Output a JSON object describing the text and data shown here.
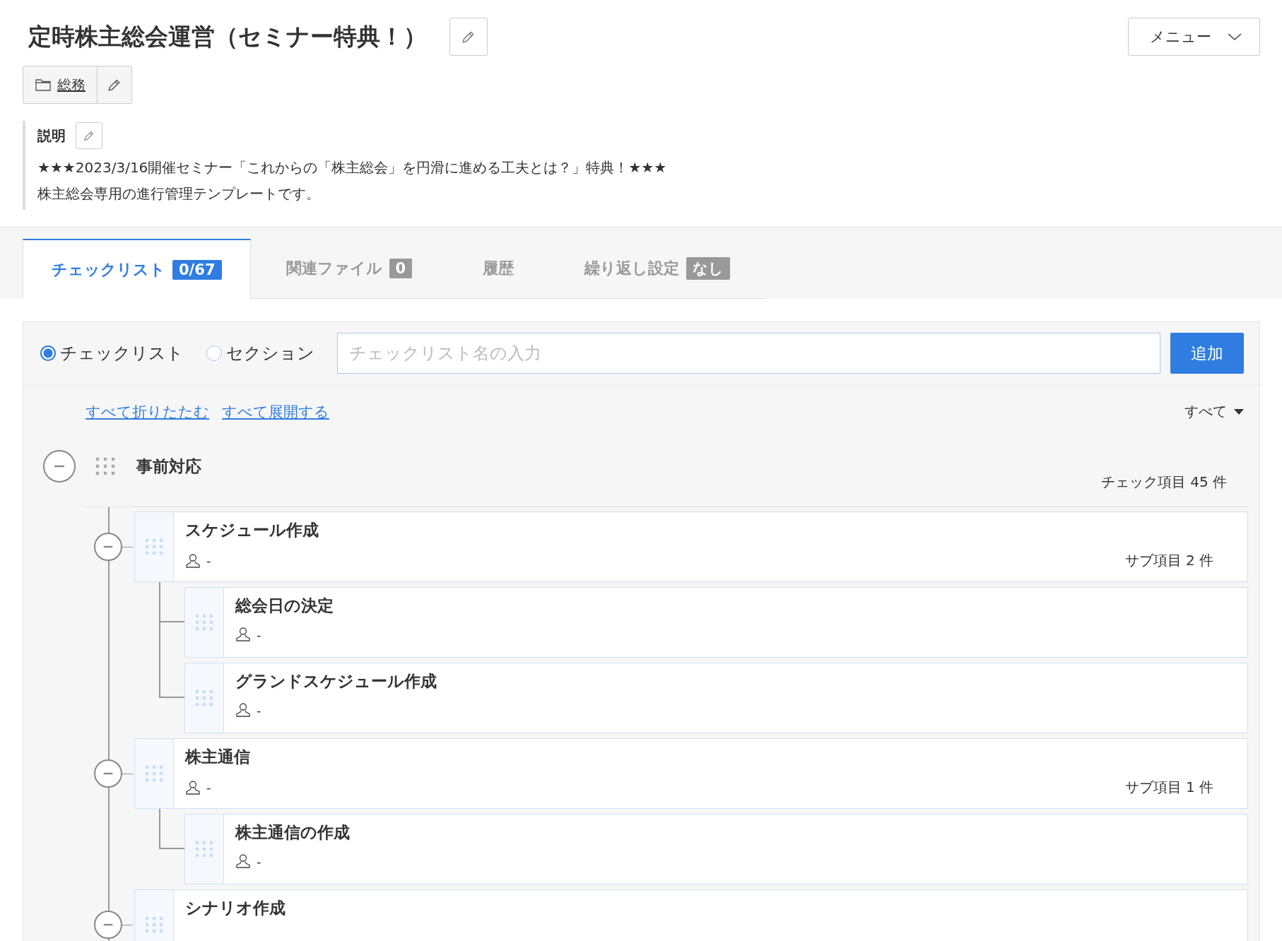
{
  "title": "定時株主総会運営（セミナー特典！）",
  "menu": {
    "label": "メニュー"
  },
  "category": {
    "label": "総務"
  },
  "description": {
    "label": "説明",
    "lines": [
      "★★★2023/3/16開催セミナー「これからの「株主総会」を円滑に進める工夫とは？」特典！★★★",
      "株主総会専用の進行管理テンプレートです。"
    ]
  },
  "tabs": [
    {
      "label": "チェックリスト",
      "badge": "0/67",
      "selected": true
    },
    {
      "label": "関連ファイル",
      "badge": "0",
      "selected": false
    },
    {
      "label": "履歴",
      "selected": false
    },
    {
      "label": "繰り返し設定",
      "badge": "なし",
      "selected": false
    }
  ],
  "add_form": {
    "types": [
      {
        "label": "チェックリスト",
        "selected": true
      },
      {
        "label": "セクション",
        "selected": false
      }
    ],
    "placeholder": "チェックリスト名の入力",
    "button": "追加"
  },
  "list_controls": {
    "collapse_all": "すべて折りたたむ",
    "expand_all": "すべて展開する",
    "filter": "すべて"
  },
  "sections": [
    {
      "title": "事前対応",
      "count": "チェック項目 45 件",
      "expanded": true,
      "children": [
        {
          "title": "スケジュール作成",
          "assignee": "-",
          "count": "サブ項目 2 件",
          "expanded": true,
          "children": [
            {
              "title": "総会日の決定",
              "assignee": "-"
            },
            {
              "title": "グランドスケジュール作成",
              "assignee": "-"
            }
          ]
        },
        {
          "title": "株主通信",
          "assignee": "-",
          "count": "サブ項目 1 件",
          "expanded": true,
          "children": [
            {
              "title": "株主通信の作成",
              "assignee": "-"
            }
          ]
        },
        {
          "title": "シナリオ作成",
          "expanded": true
        }
      ]
    }
  ]
}
